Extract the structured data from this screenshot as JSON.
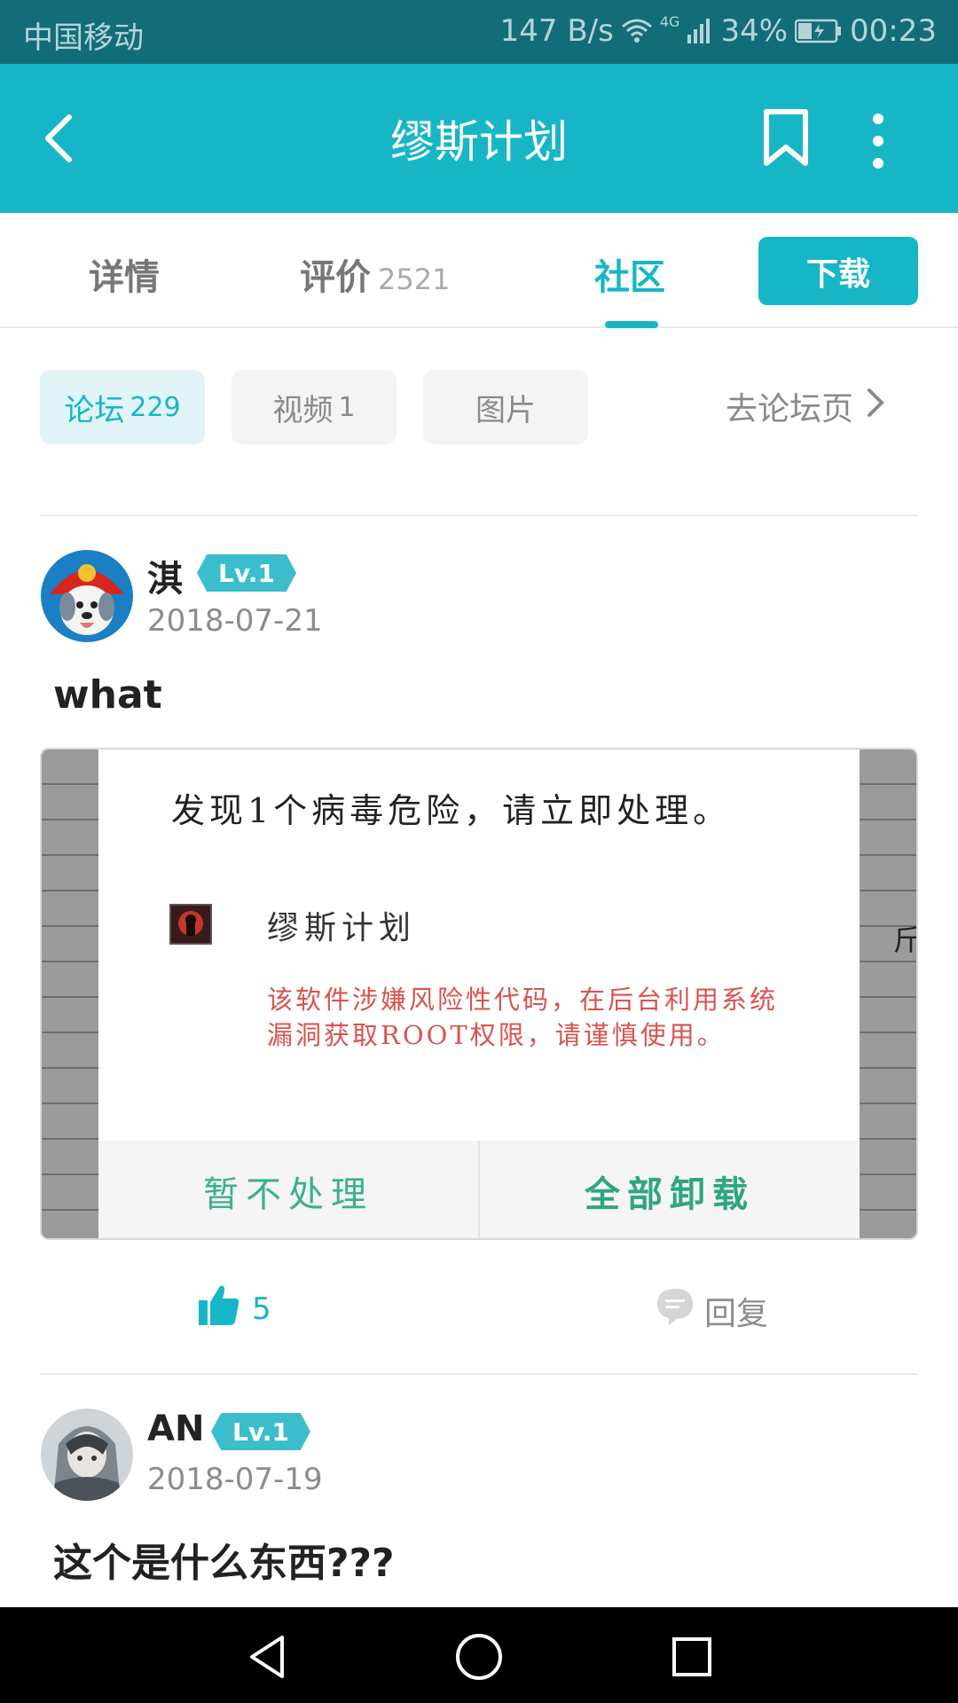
{
  "status_bar": {
    "carrier": "中国移动",
    "speed": "147 B/s",
    "network": "4G",
    "battery": "34%",
    "time": "00:23"
  },
  "app_bar": {
    "title": "缪斯计划",
    "icons": [
      "back-arrow-icon",
      "bookmark-icon",
      "more-vert-icon"
    ]
  },
  "tabs": [
    {
      "label": "详情",
      "count": ""
    },
    {
      "label": "评价",
      "count": "2521"
    },
    {
      "label": "社区",
      "count": ""
    }
  ],
  "active_tab": "社区",
  "download_label": "下载",
  "chips": [
    {
      "label": "论坛",
      "count": "229",
      "active": true
    },
    {
      "label": "视频",
      "count": "1",
      "active": false
    },
    {
      "label": "图片",
      "count": "",
      "active": false
    }
  ],
  "goto_forum_label": "去论坛页",
  "posts": [
    {
      "username": "淇",
      "level": "Lv.1",
      "date": "2018-07-21",
      "text": "what",
      "image": {
        "dialog_title": "发现1个病毒危险，请立即处理。",
        "app_name": "缪斯计划",
        "warning": "该软件涉嫌风险性代码，在后台利用系统漏洞获取ROOT权限，请谨慎使用。",
        "button_ignore": "暂不处理",
        "button_uninstall": "全部卸载",
        "side_glyph": "斤"
      },
      "likes": "5",
      "reply_label": "回复"
    },
    {
      "username": "AN",
      "level": "Lv.1",
      "date": "2018-07-19",
      "text": "这个是什么东西???"
    }
  ],
  "colors": {
    "accent": "#17b6c7",
    "status_bar": "#126d78",
    "warning_text": "#d9534f",
    "dialog_button": "#2ea681"
  }
}
